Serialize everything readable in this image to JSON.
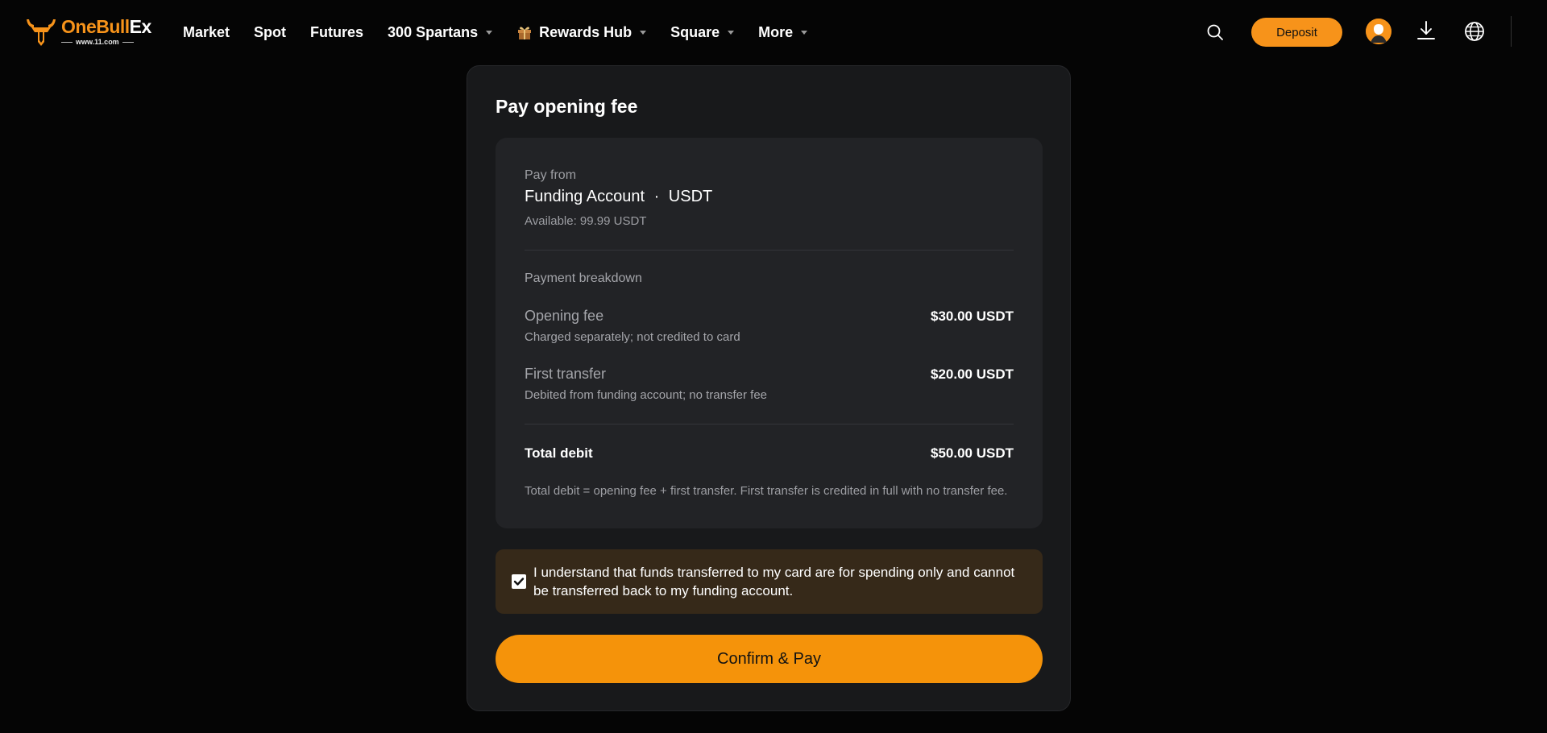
{
  "brand": {
    "name_part1": "OneBu",
    "name_part2": "ll",
    "name_part3": "Ex",
    "domain": "www.11.com",
    "accent_color": "#f7931a"
  },
  "nav": {
    "items": [
      {
        "label": "Market",
        "has_caret": false
      },
      {
        "label": "Spot",
        "has_caret": false
      },
      {
        "label": "Futures",
        "has_caret": false
      },
      {
        "label": "300 Spartans",
        "has_caret": true
      },
      {
        "label": "Rewards Hub",
        "has_caret": true,
        "icon": "gift-icon"
      },
      {
        "label": "Square",
        "has_caret": true
      },
      {
        "label": "More",
        "has_caret": true
      }
    ],
    "deposit_label": "Deposit",
    "icons": [
      "search-icon",
      "avatar",
      "download-icon",
      "globe-icon"
    ]
  },
  "modal": {
    "title": "Pay opening fee",
    "pay_from": {
      "label": "Pay from",
      "account": "Funding Account",
      "separator": "·",
      "currency": "USDT",
      "available": "Available: 99.99 USDT"
    },
    "breakdown": {
      "label": "Payment breakdown",
      "rows": [
        {
          "label": "Opening fee",
          "sub": "Charged separately; not credited to card",
          "amount": "$30.00 USDT"
        },
        {
          "label": "First transfer",
          "sub": "Debited from funding account; no transfer fee",
          "amount": "$20.00 USDT"
        }
      ],
      "total_label": "Total debit",
      "total_amount": "$50.00 USDT",
      "footnote": "Total debit = opening fee + first transfer. First transfer is credited in full with no transfer fee."
    },
    "acknowledgement": {
      "checked": true,
      "text": "I understand that funds transferred to my card are for spending only and cannot be transferred back to my funding account."
    },
    "confirm_label": "Confirm & Pay"
  }
}
